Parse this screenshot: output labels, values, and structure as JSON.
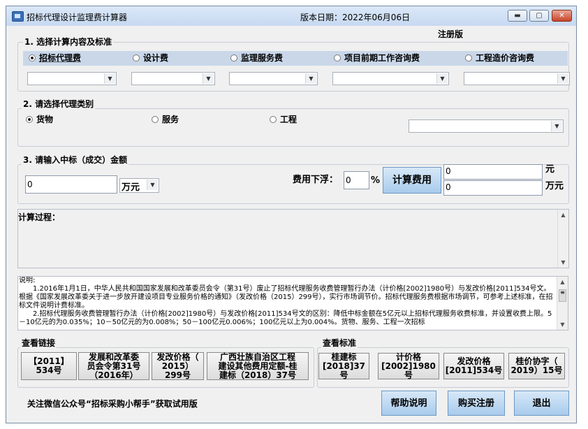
{
  "titlebar": {
    "title": "招标代理设计监理费计算器",
    "version": "版本日期：2022年06月06日"
  },
  "reg_status": "注册版",
  "section1": {
    "label": "1. 选择计算内容及标准",
    "radios": [
      "招标代理费",
      "设计费",
      "监理服务费",
      "项目前期工作咨询费",
      "工程造价咨询费"
    ],
    "selected": "招标代理费"
  },
  "section2": {
    "label": "2. 请选择代理类别",
    "radios": [
      "货物",
      "服务",
      "工程"
    ],
    "selected": "货物"
  },
  "section3": {
    "label": "3. 请输入中标（成交）金额",
    "amount_value": "0",
    "unit_select": "万元",
    "discount_label": "费用下浮：",
    "discount_value": "0",
    "percent": "%",
    "calc_button": "计算费用",
    "result_yuan": "0",
    "unit_yuan": "元",
    "result_wanyuan": "0",
    "unit_wanyuan": "万元"
  },
  "process_label": "计算过程：",
  "notes": {
    "heading": "说明:",
    "p1": "1.2016年1月1日，中华人民共和国国家发展和改革委员会令（第31号）废止了招标代理服务收费管理暂行办法（计价格[2002]1980号）与发改价格[2011]534号文。根据《国家发展改革委关于进一步放开建设项目专业服务价格的通知》（发改价格（2015）299号），实行市场调节价。招标代理服务费根据市场调节，可参考上述标准，在招标文件说明计费标准。",
    "p2": "2.招标代理服务收费管理暂行办法（计价格[2002]1980号）与发改价格[2011]534号文的区别：降低中标金额在5亿元以上招标代理服务收费标准，并设置收费上限。5－10亿元的为0.035%；10－50亿元的为0.008%；50－100亿元0.006%；100亿元以上为0.004%。货物、服务、工程一次招标"
  },
  "links": {
    "label": "查看链接",
    "buttons": [
      "【2011】\n534号",
      "发展和改革委\n员会令第31号\n（2016年）",
      "发改价格（\n2015）\n299号",
      "广西壮族自治区工程\n建设其他费用定额-桂\n建标（2018）37号"
    ]
  },
  "standards": {
    "label": "查看标准",
    "buttons": [
      "桂建标\n[2018]37号",
      "计价格\n[2002]1980号",
      "发改价格\n[2011]534号",
      "桂价协字（\n2019）15号"
    ]
  },
  "footer": {
    "wechat": "关注微信公众号“招标采购小帮手”获取试用版",
    "help": "帮助说明",
    "buy": "购买注册",
    "exit": "退出"
  },
  "icons": {
    "minimize": "minimize-icon",
    "maximize": "maximize-icon",
    "close": "close-icon",
    "dropdown": "chevron-down-icon"
  }
}
